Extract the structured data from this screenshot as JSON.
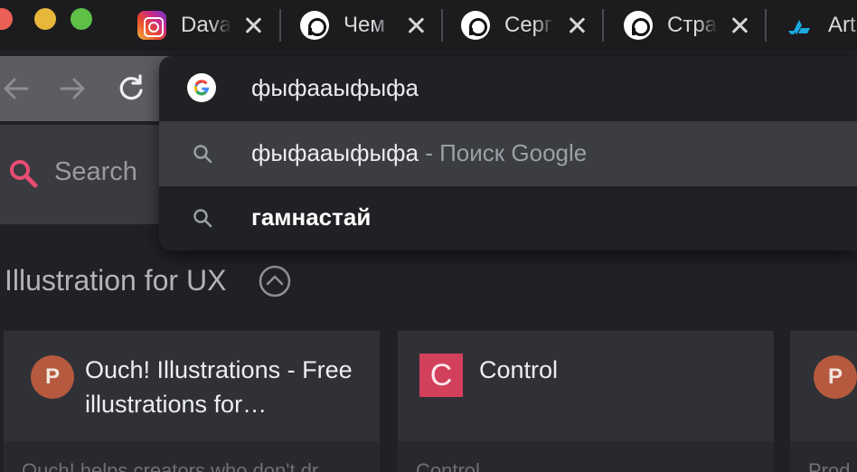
{
  "tabs": [
    {
      "title": "Dava",
      "icon": "instagram-icon"
    },
    {
      "title": "Чем",
      "icon": "pinterest-p-icon"
    },
    {
      "title": "Серг",
      "icon": "pinterest-p-icon"
    },
    {
      "title": "Стра",
      "icon": "pinterest-p-icon"
    },
    {
      "title": "Art",
      "icon": "artstation-icon"
    }
  ],
  "omnibox": {
    "query": "фыфааыфыфа",
    "suggestions": [
      {
        "text": "фыфааыфыфа",
        "suffix": " - Поиск Google",
        "selected": true
      },
      {
        "text": "гамнастай",
        "suffix": "",
        "selected": false
      }
    ]
  },
  "page": {
    "search_label": "Search",
    "section_title": "Illustration for UX",
    "cards": [
      {
        "avatar": "P",
        "title": "Ouch! Illustrations - Free illustrations for…",
        "desc": "Ouch! helps creators who don't dr"
      },
      {
        "avatar": "C",
        "title": "Control",
        "desc": "Control"
      },
      {
        "avatar": "P",
        "title": "",
        "desc": "Prod"
      }
    ]
  },
  "colors": {
    "accent_search": "#ea4c74",
    "avatar_p": "#b5593f",
    "avatar_c": "#d3405c"
  }
}
